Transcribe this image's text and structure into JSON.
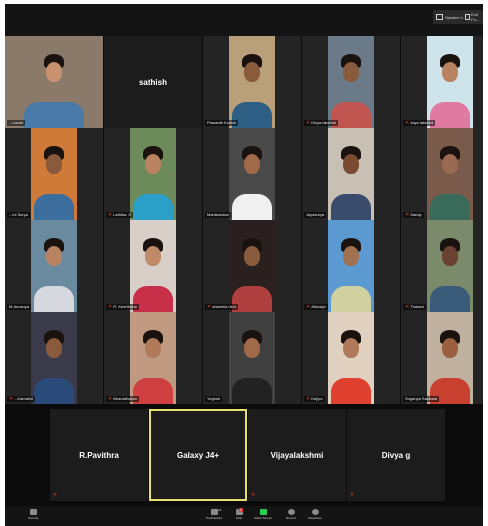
{
  "topbar": {
    "speaker_view_label": "Speaker View",
    "exit_label": "Exit Fu..."
  },
  "participants": [
    {
      "name": "...Laxmi",
      "muted": false,
      "video": true
    },
    {
      "name": "sathish",
      "muted": false,
      "video": false
    },
    {
      "name": "Prasanth Kumar",
      "muted": false,
      "video": true
    },
    {
      "name": "Divya lakshmi",
      "muted": true,
      "video": true
    },
    {
      "name": "Jaya lakshmi",
      "muted": true,
      "video": true
    },
    {
      "name": "...ini Surya",
      "muted": false,
      "video": true
    },
    {
      "name": "Lathika. S",
      "muted": true,
      "video": true
    },
    {
      "name": "Manikandan",
      "muted": false,
      "video": true
    },
    {
      "name": "Jayasurya",
      "muted": false,
      "video": true
    },
    {
      "name": "Sandy",
      "muted": true,
      "video": true
    },
    {
      "name": "M.Anusuya",
      "muted": false,
      "video": true
    },
    {
      "name": "R. Keerthana",
      "muted": true,
      "video": true
    },
    {
      "name": "sharmila devi",
      "muted": true,
      "video": true
    },
    {
      "name": "Abinaya",
      "muted": true,
      "video": true
    },
    {
      "name": "Tharani",
      "muted": true,
      "video": true
    },
    {
      "name": "...Kamalini",
      "muted": true,
      "video": true
    },
    {
      "name": "Bharadhavan",
      "muted": true,
      "video": true
    },
    {
      "name": "Yogesh",
      "muted": false,
      "video": true
    },
    {
      "name": "Dejipo",
      "muted": true,
      "video": true
    },
    {
      "name": "Suganya Sasikala",
      "muted": false,
      "video": true
    },
    {
      "name": "R.Pavithra",
      "muted": true,
      "video": false
    },
    {
      "name": "Galaxy J4+",
      "muted": false,
      "video": false,
      "active": true
    },
    {
      "name": "Vijayalakshmi",
      "muted": true,
      "video": false
    },
    {
      "name": "Divya g",
      "muted": true,
      "video": false
    }
  ],
  "toolbar": {
    "items": [
      {
        "label": "Unmute",
        "icon": "microphone-off-icon"
      },
      {
        "label": "Participants",
        "icon": "participants-icon",
        "count": "24"
      },
      {
        "label": "Chat",
        "icon": "chat-icon",
        "badge": "1"
      },
      {
        "label": "Share Screen",
        "icon": "share-screen-icon"
      },
      {
        "label": "Record",
        "icon": "record-icon"
      },
      {
        "label": "Reactions",
        "icon": "reactions-icon"
      }
    ]
  },
  "colors": {
    "active_speaker_border": "#e8e06a",
    "share_screen_green": "#2ecc55",
    "muted_red": "#e53935"
  }
}
